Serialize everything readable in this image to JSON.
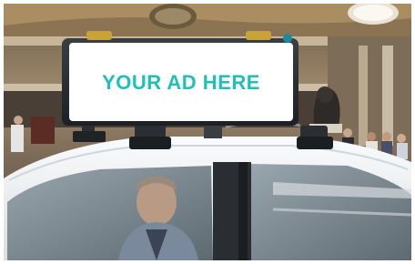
{
  "ad": {
    "text": "YOUR AD HERE",
    "text_color": "#20c0b8",
    "panel_color": "#ffffff"
  },
  "colors": {
    "car_body": "#eef1f3",
    "frame_border": "#ffffff",
    "mount_dark": "#2b2f33"
  }
}
